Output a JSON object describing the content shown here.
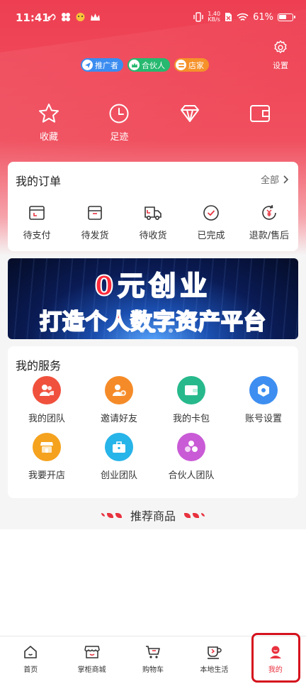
{
  "status_bar": {
    "time": "11:41",
    "net_speed_value": "1.40",
    "net_speed_unit": "KB/s",
    "battery": "61%",
    "battery_level": 0.61
  },
  "header": {
    "settings_label": "设置",
    "badges": [
      {
        "label": "推广者",
        "color": "#3b8cf0"
      },
      {
        "label": "合伙人",
        "color": "#26b96f"
      },
      {
        "label": "店家",
        "color": "#f5922a"
      }
    ]
  },
  "quick_links": [
    {
      "label": "收藏",
      "icon": "star-icon"
    },
    {
      "label": "足迹",
      "icon": "clock-icon"
    },
    {
      "label": "",
      "icon": "diamond-icon"
    },
    {
      "label": "",
      "icon": "wallet-icon"
    }
  ],
  "orders": {
    "title": "我的订单",
    "all_label": "全部",
    "items": [
      {
        "label": "待支付",
        "icon": "pending-payment-icon"
      },
      {
        "label": "待发货",
        "icon": "pending-shipment-icon"
      },
      {
        "label": "待收货",
        "icon": "truck-icon"
      },
      {
        "label": "已完成",
        "icon": "check-circle-icon"
      },
      {
        "label": "退款/售后",
        "icon": "refund-icon"
      }
    ]
  },
  "banner": {
    "line1": "0元创业",
    "line2": "打造个人数字资产平台",
    "pages": 4,
    "active_page": 1
  },
  "services": {
    "title": "我的服务",
    "items": [
      {
        "label": "我的团队",
        "icon": "team-icon",
        "color": "#f0513d"
      },
      {
        "label": "邀请好友",
        "icon": "invite-icon",
        "color": "#f58b28"
      },
      {
        "label": "我的卡包",
        "icon": "card-wallet-icon",
        "color": "#27b98b"
      },
      {
        "label": "账号设置",
        "icon": "account-settings-icon",
        "color": "#3d8ef0"
      },
      {
        "label": "我要开店",
        "icon": "shop-icon",
        "color": "#f5a21e"
      },
      {
        "label": "创业团队",
        "icon": "briefcase-icon",
        "color": "#27b4e8"
      },
      {
        "label": "合伙人团队",
        "icon": "partner-icon",
        "color": "#c95bd6"
      }
    ]
  },
  "recommend": {
    "title": "推荐商品"
  },
  "tabbar": {
    "tabs": [
      {
        "label": "首页",
        "icon": "home-icon"
      },
      {
        "label": "掌柜商城",
        "icon": "store-icon"
      },
      {
        "label": "购物车",
        "icon": "cart-icon"
      },
      {
        "label": "本地生活",
        "icon": "coffee-icon"
      },
      {
        "label": "我的",
        "icon": "profile-icon"
      }
    ],
    "active_index": 4
  },
  "colors": {
    "brand_red": "#e8323f",
    "highlight": "#d4121d"
  }
}
